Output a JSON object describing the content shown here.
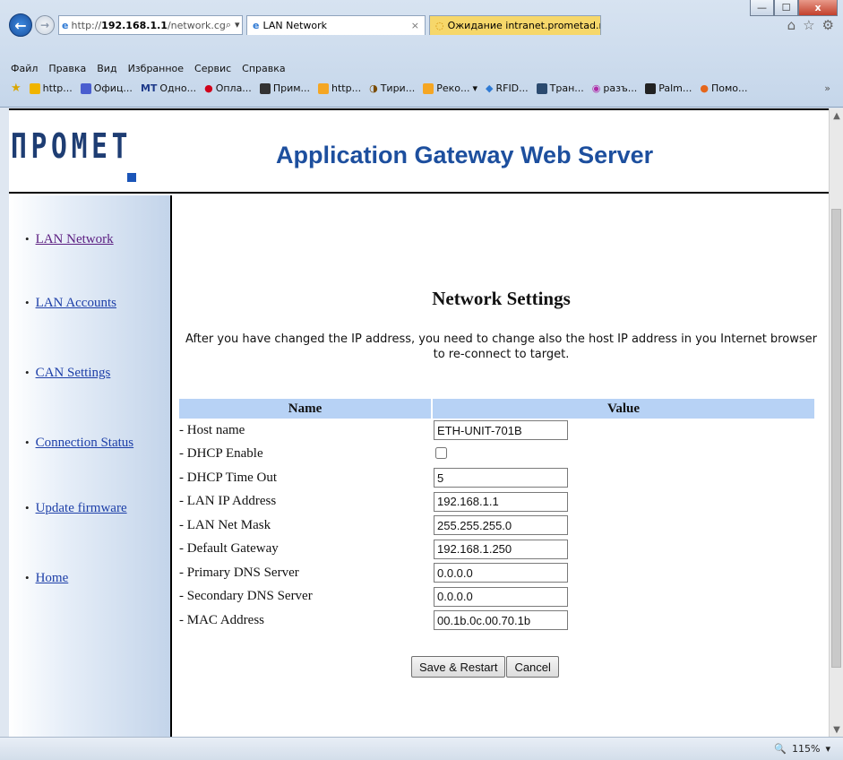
{
  "browser": {
    "address": "http://192.168.1.1/network.cg",
    "address_host": "192.168.1.1",
    "address_path": "/network.cg",
    "tabs": [
      {
        "label": "LAN Network",
        "active": true
      },
      {
        "label": "Ожидание intranet.prometad.ru",
        "active": false
      }
    ],
    "menu": [
      "Файл",
      "Правка",
      "Вид",
      "Избранное",
      "Сервис",
      "Справка"
    ],
    "favorites": [
      "http...",
      "Офиц...",
      "Одно...",
      "Опла...",
      "Прим...",
      "http...",
      "Тири...",
      "Реко...",
      "RFID...",
      "Тран...",
      "разъ...",
      "Palm...",
      "Помо..."
    ],
    "favorite_prefixes": {
      "mt": "MT"
    },
    "zoom": "115%",
    "window_buttons": {
      "minimize": "—",
      "maximize": "☐",
      "close": "x"
    }
  },
  "page": {
    "logo_text": "ПРОМЕТ",
    "title": "Application Gateway Web Server",
    "sidebar": [
      {
        "label": "LAN Network",
        "visited": true
      },
      {
        "label": "LAN Accounts",
        "visited": false
      },
      {
        "label": "CAN Settings",
        "visited": false
      },
      {
        "label": "Connection Status",
        "visited": false
      },
      {
        "label": "Update firmware",
        "visited": false
      },
      {
        "label": "Home",
        "visited": false
      }
    ],
    "section_title": "Network Settings",
    "intro": "After you have changed the IP address, you need to change also the host IP address in you Internet browser to re-connect to target.",
    "table": {
      "headers": [
        "Name",
        "Value"
      ],
      "rows": [
        {
          "label": "- Host name",
          "value": "ETH-UNIT-701B",
          "type": "text"
        },
        {
          "label": "- DHCP Enable",
          "value": "",
          "type": "checkbox",
          "checked": false
        },
        {
          "label": "- DHCP Time Out",
          "value": "5",
          "type": "text"
        },
        {
          "label": "- LAN IP Address",
          "value": "192.168.1.1",
          "type": "text"
        },
        {
          "label": "- LAN Net Mask",
          "value": "255.255.255.0",
          "type": "text"
        },
        {
          "label": "- Default Gateway",
          "value": "192.168.1.250",
          "type": "text"
        },
        {
          "label": "- Primary DNS Server",
          "value": "0.0.0.0",
          "type": "text"
        },
        {
          "label": "- Secondary DNS Server",
          "value": "0.0.0.0",
          "type": "text"
        },
        {
          "label": "- MAC Address",
          "value": "00.1b.0c.00.70.1b",
          "type": "text"
        }
      ]
    },
    "buttons": {
      "save": "Save & Restart",
      "cancel": "Cancel"
    }
  },
  "colors": {
    "title_blue": "#1d4f9e",
    "link_blue": "#1d3fa8",
    "link_visited": "#5b1d80",
    "table_header": "#b7d2f5"
  }
}
